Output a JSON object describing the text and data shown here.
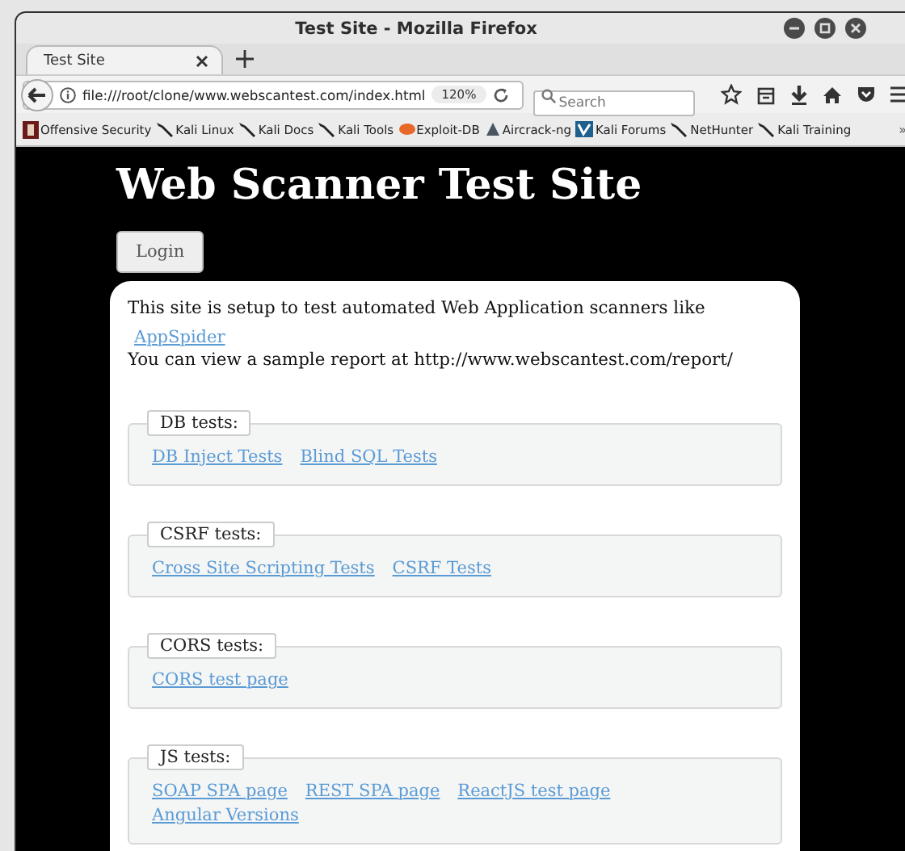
{
  "window": {
    "title": "Test Site - Mozilla Firefox"
  },
  "tabs": [
    {
      "label": "Test Site",
      "selected": true
    }
  ],
  "address_bar": {
    "url": "file:///root/clone/www.webscantest.com/index.html",
    "zoom": "120%"
  },
  "search": {
    "placeholder": "Search"
  },
  "bookmarks": [
    {
      "label": "Offensive Security",
      "kind": "offsec"
    },
    {
      "label": "Kali Linux",
      "kind": "kali"
    },
    {
      "label": "Kali Docs",
      "kind": "kali"
    },
    {
      "label": "Kali Tools",
      "kind": "kali"
    },
    {
      "label": "Exploit-DB",
      "kind": "exploit"
    },
    {
      "label": "Aircrack-ng",
      "kind": "aircrack"
    },
    {
      "label": "Kali Forums",
      "kind": "forums"
    },
    {
      "label": "NetHunter",
      "kind": "kali"
    },
    {
      "label": "Kali Training",
      "kind": "kali"
    }
  ],
  "bookmarks_overflow": "»",
  "page": {
    "heading": "Web Scanner Test Site",
    "login_button": "Login",
    "intro": "This site is setup to test automated Web Application scanners like",
    "intro_link": "AppSpider",
    "report_note": "You can view a sample report at http://www.webscantest.com/report/",
    "sections": [
      {
        "legend": "DB tests:",
        "links": [
          "DB Inject Tests",
          "Blind SQL Tests"
        ]
      },
      {
        "legend": "CSRF tests:",
        "links": [
          "Cross Site Scripting Tests",
          "CSRF Tests"
        ]
      },
      {
        "legend": "CORS tests:",
        "links": [
          "CORS test page"
        ]
      },
      {
        "legend": "JS tests:",
        "links": [
          "SOAP SPA page",
          "REST SPA page",
          "ReactJS test page",
          "Angular Versions"
        ]
      }
    ]
  }
}
